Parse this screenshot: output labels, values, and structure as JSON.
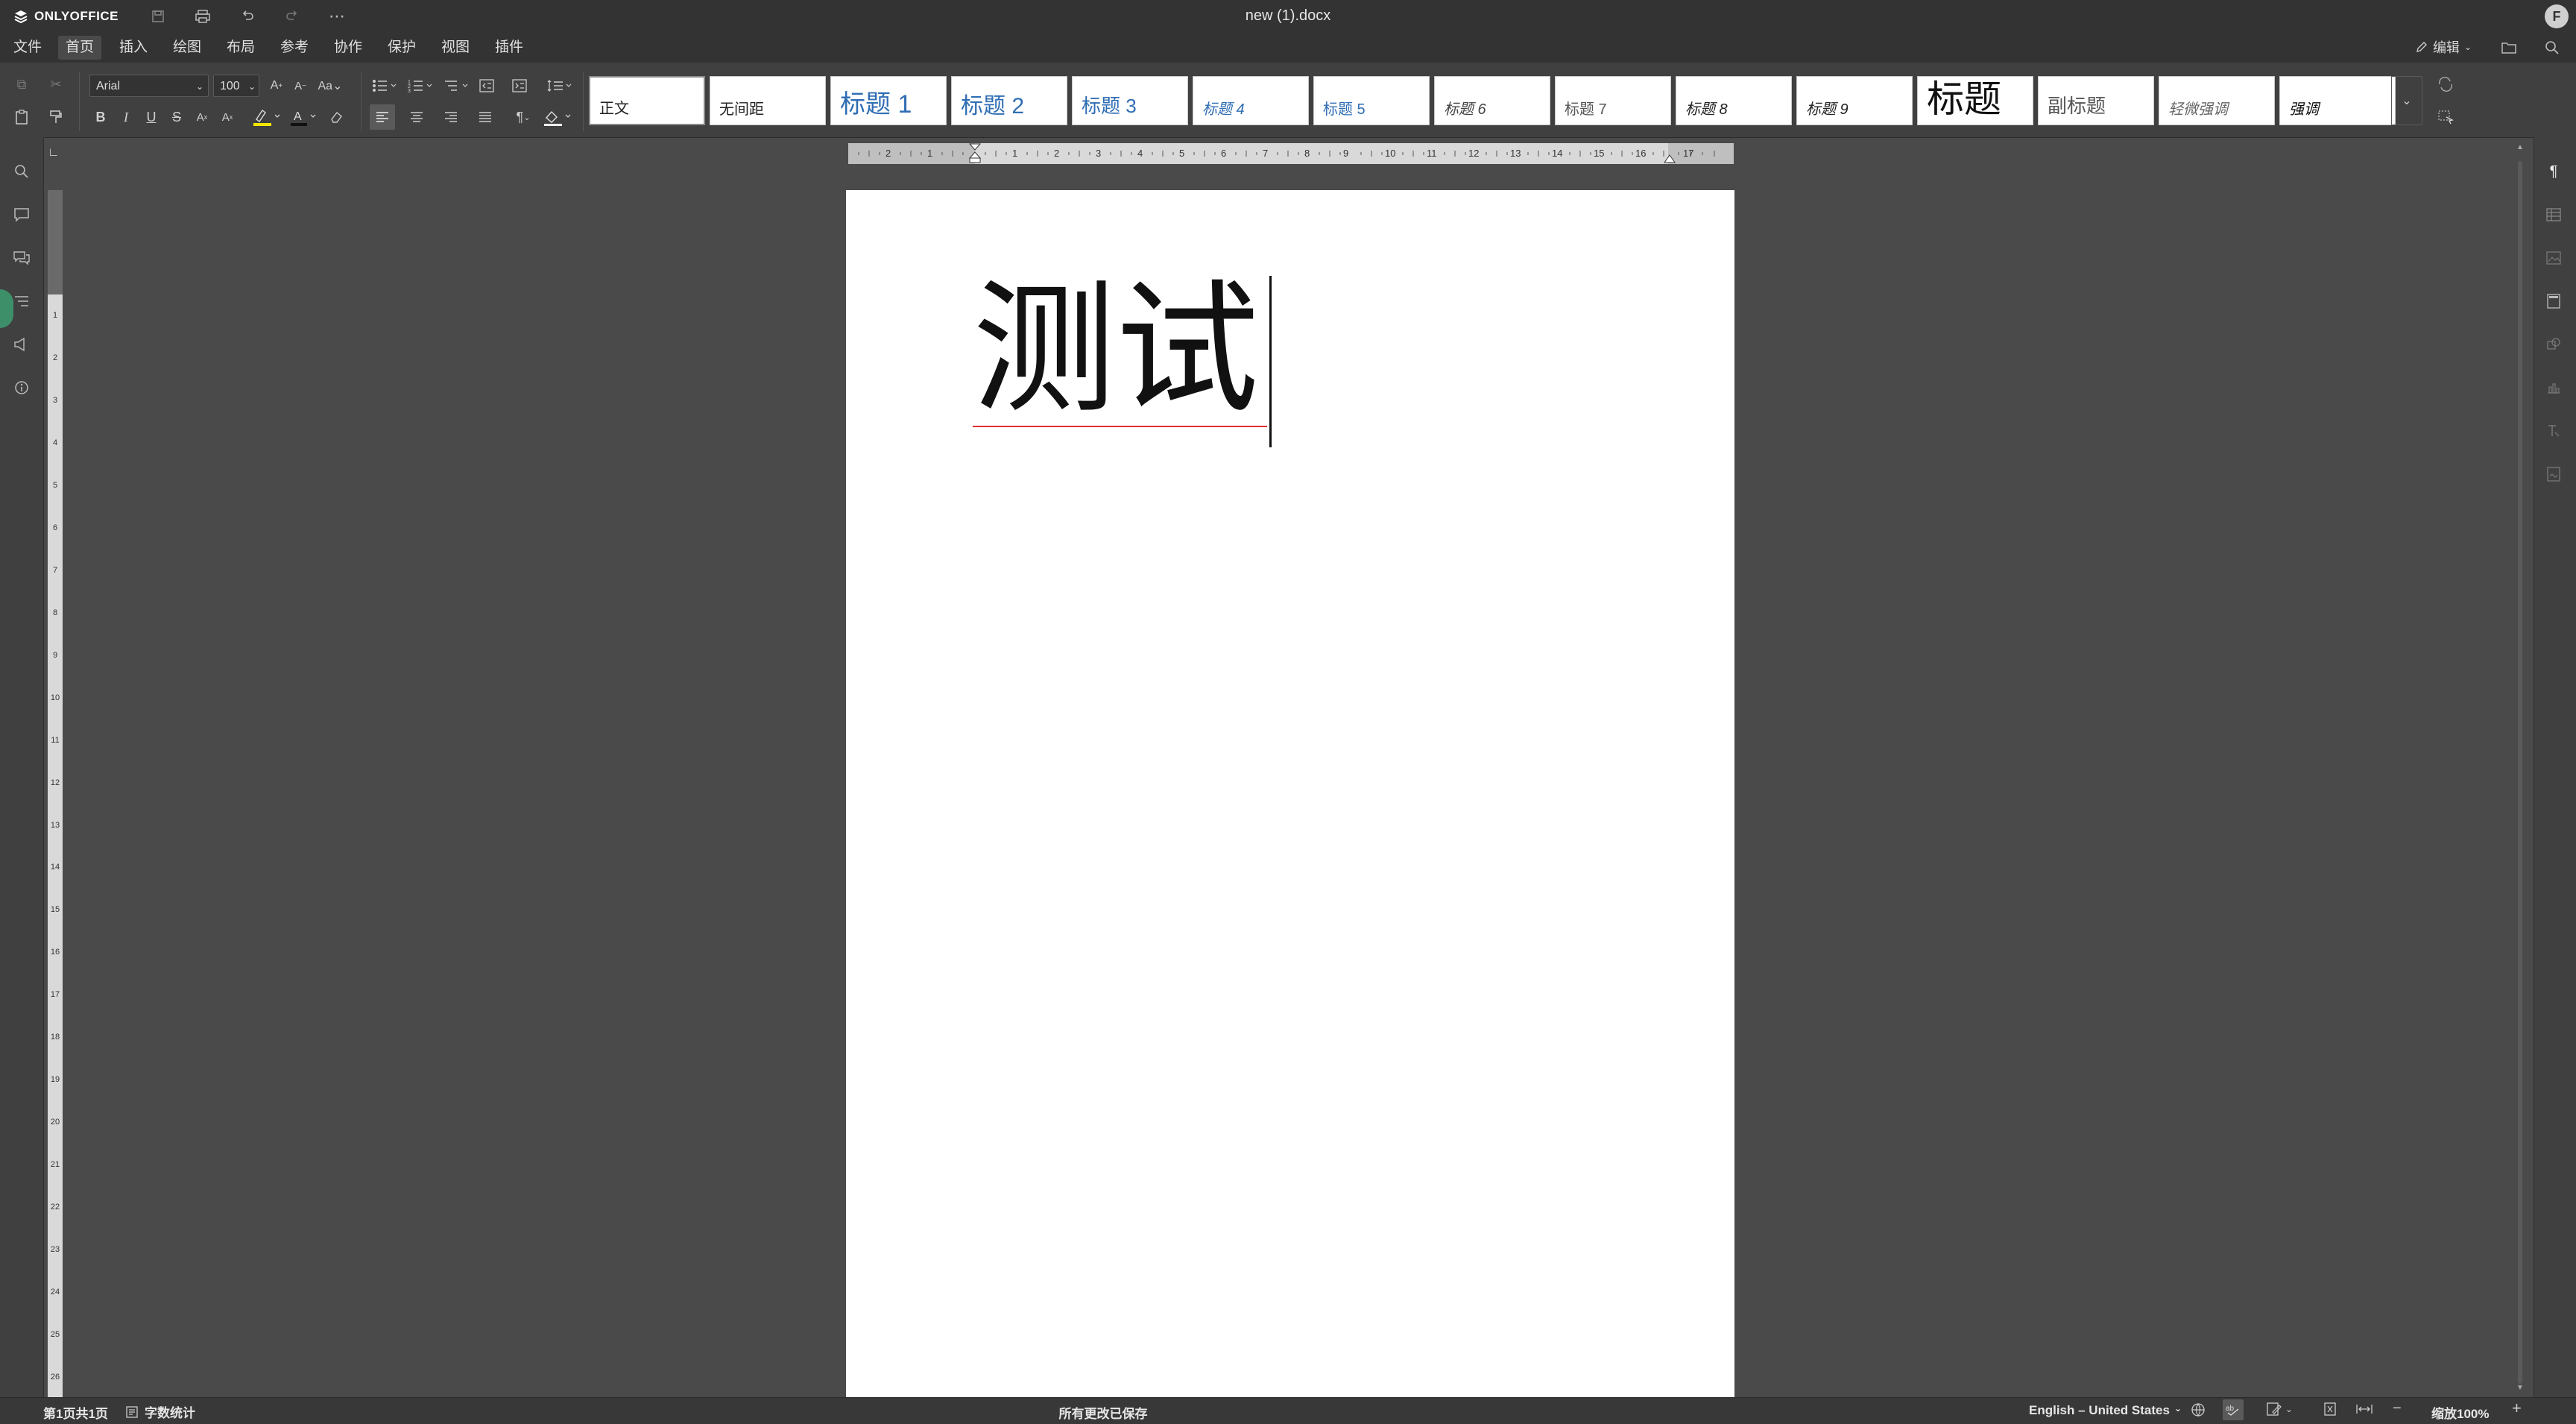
{
  "app": {
    "brand": "ONLYOFFICE",
    "document_title": "new (1).docx",
    "user_initial": "F"
  },
  "menu": {
    "items": [
      "文件",
      "首页",
      "插入",
      "绘图",
      "布局",
      "参考",
      "协作",
      "保护",
      "视图",
      "插件"
    ],
    "active": "首页",
    "edit_mode": "编辑"
  },
  "toolbar": {
    "font_name": "Arial",
    "font_size": "100",
    "styles": [
      "正文",
      "无间距",
      "标题 1",
      "标题 2",
      "标题 3",
      "标题 4",
      "标题 5",
      "标题 6",
      "标题 7",
      "标题 8",
      "标题 9",
      "标题",
      "副标题",
      "轻微强调",
      "强调"
    ]
  },
  "ruler": {
    "top_ticks": [
      "2",
      "1",
      "1",
      "2",
      "3",
      "4",
      "5",
      "6",
      "7",
      "8",
      "9",
      "10",
      "11",
      "12",
      "13",
      "14",
      "15",
      "16",
      "17"
    ],
    "left_ticks": [
      "1",
      "2",
      "3",
      "4",
      "5",
      "6",
      "7",
      "8",
      "9",
      "10",
      "11",
      "12",
      "13",
      "14",
      "15",
      "16",
      "17",
      "18",
      "19",
      "20",
      "21",
      "22",
      "23",
      "24",
      "25",
      "26"
    ]
  },
  "document": {
    "text": "测试"
  },
  "status": {
    "page_info": "第1页共1页",
    "word_count": "字数统计",
    "save_state": "所有更改已保存",
    "language": "English – United States",
    "zoom": "缩放100%"
  },
  "colors": {
    "accent": "#4472c4",
    "chrome": "#333333",
    "toolbar": "#404040",
    "workspace": "#4a4a4a",
    "spell_underline": "#e03030"
  }
}
